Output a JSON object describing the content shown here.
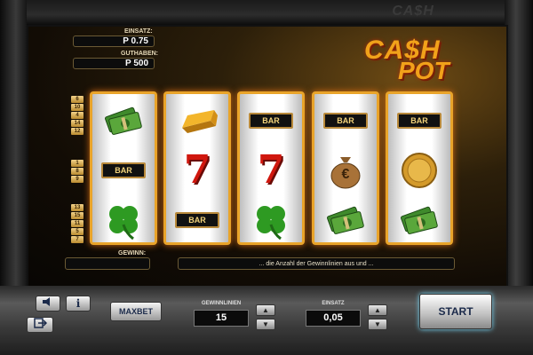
{
  "cabinet": {
    "top_logo": "CA$H"
  },
  "info": {
    "einsatz_label": "EINSATZ:",
    "einsatz_value": "P 0.75",
    "guthaben_label": "GUTHABEN:",
    "guthaben_value": "P 500"
  },
  "logo": {
    "line1": "CA$H",
    "line2": "POT"
  },
  "paylines": {
    "top_group": [
      "6",
      "10",
      "4",
      "14",
      "12"
    ],
    "middle_group": [
      "1",
      "8",
      "9"
    ],
    "bottom_group": [
      "13",
      "15",
      "11",
      "5",
      "7"
    ]
  },
  "reels": [
    {
      "symbols": [
        "money",
        "bar",
        "clover"
      ]
    },
    {
      "symbols": [
        "gold-bar",
        "seven",
        "bar"
      ]
    },
    {
      "symbols": [
        "bar",
        "seven",
        "clover"
      ]
    },
    {
      "symbols": [
        "bar",
        "money-bag",
        "money"
      ]
    },
    {
      "symbols": [
        "bar",
        "coin",
        "money"
      ]
    }
  ],
  "symbol_text": {
    "bar": "BAR",
    "seven": "7",
    "euro": "€"
  },
  "win": {
    "label": "GEWINN:",
    "value": ""
  },
  "message": "... die Anzahl der Gewinnlinien aus und ...",
  "controls": {
    "maxbet_label": "MAXBET",
    "lines_label": "GEWINNLINIEN",
    "lines_value": "15",
    "bet_label": "EINSATZ",
    "bet_value": "0,05",
    "start_label": "START",
    "info_label": "i",
    "sound_icon": "speaker-icon",
    "exit_icon": "exit-icon"
  },
  "colors": {
    "reel_border": "#e9a42a",
    "logo": "#f1a21a",
    "seven": "#d0170e"
  }
}
